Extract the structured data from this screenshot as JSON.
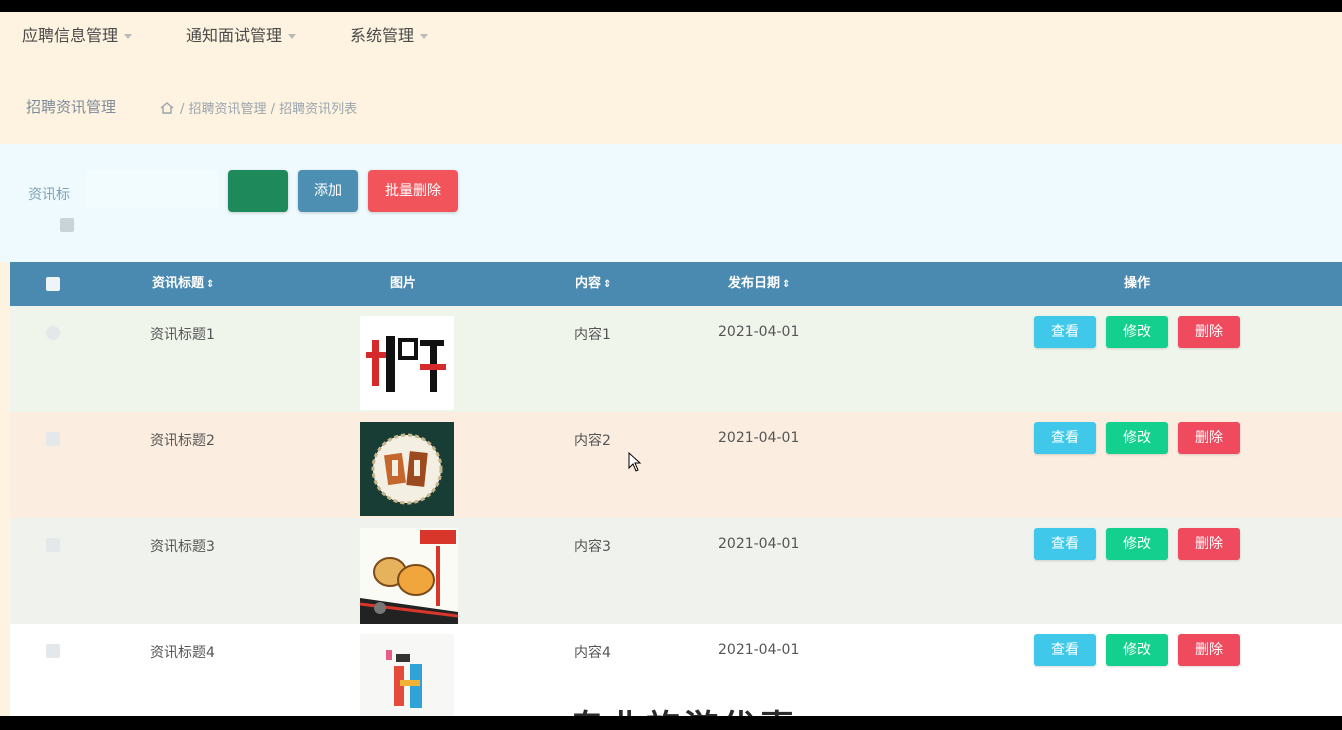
{
  "nav": {
    "menus": [
      {
        "label": "应聘信息管理"
      },
      {
        "label": "通知面试管理"
      },
      {
        "label": "系统管理"
      }
    ]
  },
  "breadcrumb": {
    "title": "招聘资讯管理",
    "path": "/ 招聘资讯管理 / 招聘资讯列表"
  },
  "search": {
    "label": "资讯标",
    "input_value": "",
    "search_button": "",
    "add_button": "添加",
    "batch_delete_button": "批量删除"
  },
  "table": {
    "columns": [
      "资讯标题",
      "图片",
      "内容",
      "发布日期",
      "操作"
    ],
    "rows": [
      {
        "title": "资讯标题1",
        "content": "内容1",
        "date": "2021-04-01"
      },
      {
        "title": "资讯标题2",
        "content": "内容2",
        "date": "2021-04-01"
      },
      {
        "title": "资讯标题3",
        "content": "内容3",
        "date": "2021-04-01"
      },
      {
        "title": "资讯标题4",
        "content": "内容4",
        "date": "2021-04-01"
      }
    ],
    "actions": {
      "view": "查看",
      "edit": "修改",
      "delete": "删除"
    }
  },
  "footer_text": "专业旅游优惠",
  "colors": {
    "header": "#4b8ab0",
    "view": "#3fc8ea",
    "edit": "#13d08e",
    "delete": "#ef4a5e"
  }
}
